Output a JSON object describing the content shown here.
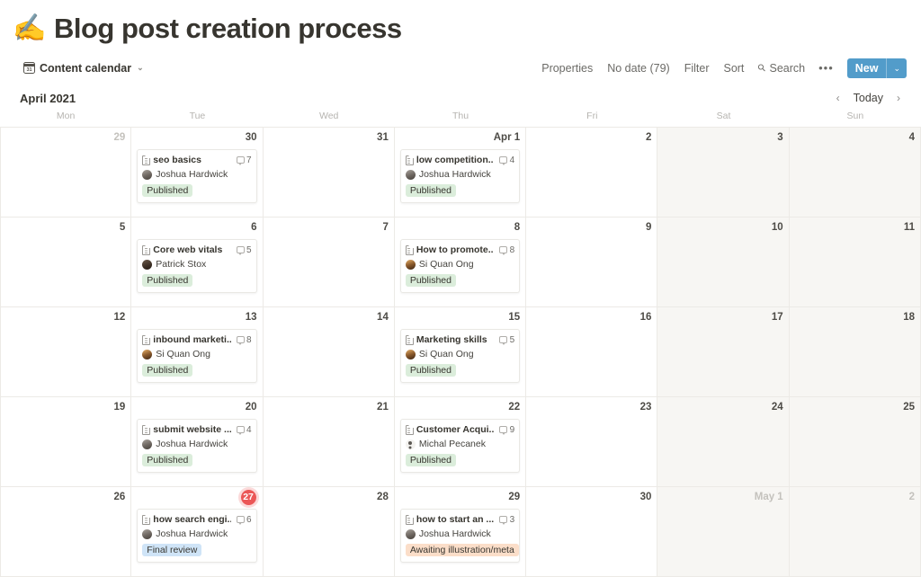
{
  "page": {
    "emoji": "✍️",
    "title": "Blog post creation process"
  },
  "view": {
    "icon": "calendar-icon",
    "label": "Content calendar",
    "chevron": "⌄"
  },
  "toolbar": {
    "properties": "Properties",
    "no_date": "No date (79)",
    "filter": "Filter",
    "sort": "Sort",
    "search": "Search",
    "more": "•••",
    "new_label": "New",
    "new_chevron": "⌄"
  },
  "calendar": {
    "month": "April 2021",
    "prev": "‹",
    "today": "Today",
    "next": "›",
    "weekdays": [
      "Mon",
      "Tue",
      "Wed",
      "Thu",
      "Fri",
      "Sat",
      "Sun"
    ],
    "weeks": [
      [
        {
          "day": "29",
          "muted": true,
          "weekend": false
        },
        {
          "day": "30",
          "muted": false,
          "weekend": false,
          "event": {
            "title": "seo basics",
            "comments": "7",
            "person": "Joshua Hardwick",
            "avatar": "a-josh",
            "status": "Published",
            "status_class": "published"
          }
        },
        {
          "day": "31",
          "muted": false,
          "weekend": false
        },
        {
          "day": "Apr 1",
          "muted": false,
          "weekend": false,
          "event": {
            "title": "low competition...",
            "comments": "4",
            "person": "Joshua Hardwick",
            "avatar": "a-josh",
            "status": "Published",
            "status_class": "published"
          }
        },
        {
          "day": "2",
          "muted": false,
          "weekend": false
        },
        {
          "day": "3",
          "muted": false,
          "weekend": true
        },
        {
          "day": "4",
          "muted": false,
          "weekend": true
        }
      ],
      [
        {
          "day": "5",
          "muted": false,
          "weekend": false
        },
        {
          "day": "6",
          "muted": false,
          "weekend": false,
          "event": {
            "title": "Core web vitals",
            "comments": "5",
            "person": "Patrick Stox",
            "avatar": "a-patrick",
            "status": "Published",
            "status_class": "published"
          }
        },
        {
          "day": "7",
          "muted": false,
          "weekend": false
        },
        {
          "day": "8",
          "muted": false,
          "weekend": false,
          "event": {
            "title": "How to promote...",
            "comments": "8",
            "person": "Si Quan Ong",
            "avatar": "a-siquan",
            "status": "Published",
            "status_class": "published"
          }
        },
        {
          "day": "9",
          "muted": false,
          "weekend": false
        },
        {
          "day": "10",
          "muted": false,
          "weekend": true
        },
        {
          "day": "11",
          "muted": false,
          "weekend": true
        }
      ],
      [
        {
          "day": "12",
          "muted": false,
          "weekend": false
        },
        {
          "day": "13",
          "muted": false,
          "weekend": false,
          "event": {
            "title": "inbound marketi...",
            "comments": "8",
            "person": "Si Quan Ong",
            "avatar": "a-siquan",
            "status": "Published",
            "status_class": "published"
          }
        },
        {
          "day": "14",
          "muted": false,
          "weekend": false
        },
        {
          "day": "15",
          "muted": false,
          "weekend": false,
          "event": {
            "title": "Marketing skills",
            "comments": "5",
            "person": "Si Quan Ong",
            "avatar": "a-siquan",
            "status": "Published",
            "status_class": "published"
          }
        },
        {
          "day": "16",
          "muted": false,
          "weekend": false
        },
        {
          "day": "17",
          "muted": false,
          "weekend": true
        },
        {
          "day": "18",
          "muted": false,
          "weekend": true
        }
      ],
      [
        {
          "day": "19",
          "muted": false,
          "weekend": false
        },
        {
          "day": "20",
          "muted": false,
          "weekend": false,
          "event": {
            "title": "submit website ...",
            "comments": "4",
            "person": "Joshua Hardwick",
            "avatar": "a-josh",
            "status": "Published",
            "status_class": "published"
          }
        },
        {
          "day": "21",
          "muted": false,
          "weekend": false
        },
        {
          "day": "22",
          "muted": false,
          "weekend": false,
          "event": {
            "title": "Customer Acqui...",
            "comments": "9",
            "person": "Michal Pecanek",
            "avatar": "a-michal",
            "status": "Published",
            "status_class": "published"
          }
        },
        {
          "day": "23",
          "muted": false,
          "weekend": false
        },
        {
          "day": "24",
          "muted": false,
          "weekend": true
        },
        {
          "day": "25",
          "muted": false,
          "weekend": true
        }
      ],
      [
        {
          "day": "26",
          "muted": false,
          "weekend": false
        },
        {
          "day": "27",
          "muted": false,
          "weekend": false,
          "today": true,
          "event": {
            "title": "how search engi...",
            "comments": "6",
            "person": "Joshua Hardwick",
            "avatar": "a-josh",
            "status": "Final review",
            "status_class": "final-review"
          }
        },
        {
          "day": "28",
          "muted": false,
          "weekend": false
        },
        {
          "day": "29",
          "muted": false,
          "weekend": false,
          "event": {
            "title": "how to start an ...",
            "comments": "3",
            "person": "Joshua Hardwick",
            "avatar": "a-josh",
            "status": "Awaiting illustration/meta",
            "status_class": "awaiting"
          }
        },
        {
          "day": "30",
          "muted": false,
          "weekend": false
        },
        {
          "day": "May 1",
          "muted": true,
          "weekend": true
        },
        {
          "day": "2",
          "muted": true,
          "weekend": true
        }
      ]
    ]
  },
  "colors": {
    "accent_blue": "#529cca",
    "today_red": "#eb5757",
    "status_published": "#dbeddb",
    "status_final_review": "#cfe4f7",
    "status_awaiting": "#fbdec9",
    "grid_line": "#eceae6",
    "weekend_bg": "#f7f6f3"
  }
}
